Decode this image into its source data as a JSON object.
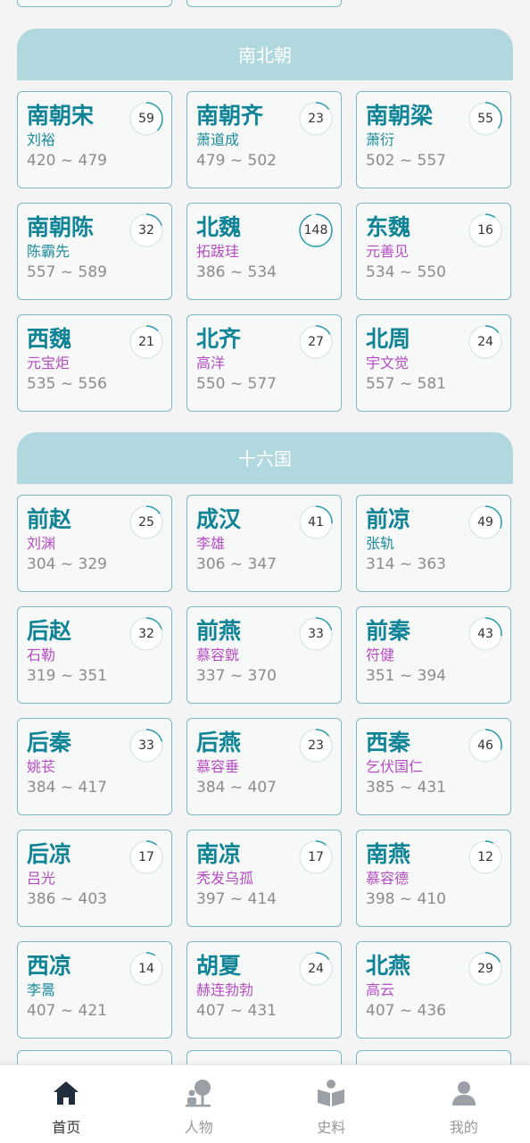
{
  "sections": [
    {
      "title": "南北朝",
      "dynasties": [
        {
          "name": "南朝宋",
          "ruler": "刘裕",
          "gender": "male",
          "years": "420 ~ 479",
          "count": "59",
          "progress": 0.38
        },
        {
          "name": "南朝齐",
          "ruler": "萧道成",
          "gender": "male",
          "years": "479 ~ 502",
          "count": "23",
          "progress": 0.15
        },
        {
          "name": "南朝梁",
          "ruler": "萧衍",
          "gender": "male",
          "years": "502 ~ 557",
          "count": "55",
          "progress": 0.35
        },
        {
          "name": "南朝陈",
          "ruler": "陈霸先",
          "gender": "male",
          "years": "557 ~ 589",
          "count": "32",
          "progress": 0.2
        },
        {
          "name": "北魏",
          "ruler": "拓跋珪",
          "gender": "female",
          "years": "386 ~ 534",
          "count": "148",
          "progress": 0.95
        },
        {
          "name": "东魏",
          "ruler": "元善见",
          "gender": "female",
          "years": "534 ~ 550",
          "count": "16",
          "progress": 0.1
        },
        {
          "name": "西魏",
          "ruler": "元宝炬",
          "gender": "female",
          "years": "535 ~ 556",
          "count": "21",
          "progress": 0.13
        },
        {
          "name": "北齐",
          "ruler": "高洋",
          "gender": "female",
          "years": "550 ~ 577",
          "count": "27",
          "progress": 0.17
        },
        {
          "name": "北周",
          "ruler": "宇文觉",
          "gender": "female",
          "years": "557 ~ 581",
          "count": "24",
          "progress": 0.15
        }
      ]
    },
    {
      "title": "十六国",
      "dynasties": [
        {
          "name": "前赵",
          "ruler": "刘渊",
          "gender": "female",
          "years": "304 ~ 329",
          "count": "25",
          "progress": 0.16
        },
        {
          "name": "成汉",
          "ruler": "李雄",
          "gender": "female",
          "years": "306 ~ 347",
          "count": "41",
          "progress": 0.26
        },
        {
          "name": "前凉",
          "ruler": "张轨",
          "gender": "male",
          "years": "314 ~ 363",
          "count": "49",
          "progress": 0.31
        },
        {
          "name": "后赵",
          "ruler": "石勒",
          "gender": "female",
          "years": "319 ~ 351",
          "count": "32",
          "progress": 0.2
        },
        {
          "name": "前燕",
          "ruler": "慕容皝",
          "gender": "female",
          "years": "337 ~ 370",
          "count": "33",
          "progress": 0.21
        },
        {
          "name": "前秦",
          "ruler": "符健",
          "gender": "female",
          "years": "351 ~ 394",
          "count": "43",
          "progress": 0.27
        },
        {
          "name": "后秦",
          "ruler": "姚苌",
          "gender": "female",
          "years": "384 ~ 417",
          "count": "33",
          "progress": 0.21
        },
        {
          "name": "后燕",
          "ruler": "慕容垂",
          "gender": "female",
          "years": "384 ~ 407",
          "count": "23",
          "progress": 0.15
        },
        {
          "name": "西秦",
          "ruler": "乞伏国仁",
          "gender": "female",
          "years": "385 ~ 431",
          "count": "46",
          "progress": 0.29
        },
        {
          "name": "后凉",
          "ruler": "吕光",
          "gender": "female",
          "years": "386 ~ 403",
          "count": "17",
          "progress": 0.11
        },
        {
          "name": "南凉",
          "ruler": "秃发乌孤",
          "gender": "female",
          "years": "397 ~ 414",
          "count": "17",
          "progress": 0.11
        },
        {
          "name": "南燕",
          "ruler": "慕容德",
          "gender": "female",
          "years": "398 ~ 410",
          "count": "12",
          "progress": 0.08
        },
        {
          "name": "西凉",
          "ruler": "李暠",
          "gender": "male",
          "years": "407 ~ 421",
          "count": "14",
          "progress": 0.09
        },
        {
          "name": "胡夏",
          "ruler": "赫连勃勃",
          "gender": "female",
          "years": "407 ~ 431",
          "count": "24",
          "progress": 0.15
        },
        {
          "name": "北燕",
          "ruler": "高云",
          "gender": "female",
          "years": "407 ~ 436",
          "count": "29",
          "progress": 0.18
        }
      ]
    }
  ],
  "tabs": [
    {
      "label": "首页",
      "icon": "home-icon",
      "active": true
    },
    {
      "label": "人物",
      "icon": "person-tree-icon",
      "active": false
    },
    {
      "label": "史料",
      "icon": "book-icon",
      "active": false
    },
    {
      "label": "我的",
      "icon": "user-icon",
      "active": false
    }
  ],
  "colors": {
    "accent": "#0f8496",
    "header_bg": "#b0d8de",
    "card_border": "#7cb8c4",
    "male_ruler": "#1b8a9c",
    "female_ruler": "#b64cc3",
    "years": "#8c8c8c"
  }
}
